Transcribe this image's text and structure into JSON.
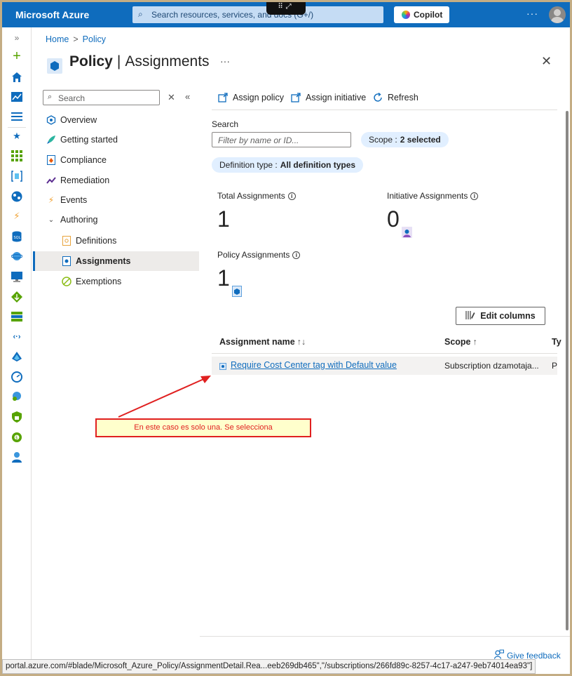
{
  "topbar": {
    "brand": "Microsoft Azure",
    "search_placeholder": "Search resources, services, and docs (G+/)",
    "copilot_label": "Copilot",
    "more": "···"
  },
  "breadcrumb": {
    "home": "Home",
    "policy": "Policy",
    "sep": ">"
  },
  "header": {
    "title_main": "Policy",
    "title_sep": "|",
    "title_sub": "Assignments",
    "more": "···",
    "close": "✕"
  },
  "nav": {
    "search_placeholder": "Search",
    "clear": "✕",
    "collapse": "«",
    "items": [
      {
        "label": "Overview"
      },
      {
        "label": "Getting started"
      },
      {
        "label": "Compliance"
      },
      {
        "label": "Remediation"
      },
      {
        "label": "Events"
      },
      {
        "label": "Authoring"
      },
      {
        "label": "Definitions"
      },
      {
        "label": "Assignments"
      },
      {
        "label": "Exemptions"
      }
    ]
  },
  "toolbar": {
    "assign_policy": "Assign policy",
    "assign_initiative": "Assign initiative",
    "refresh": "Refresh"
  },
  "filters": {
    "search_label": "Search",
    "search_placeholder": "Filter by name or ID...",
    "scope_label": "Scope :",
    "scope_value": "2 selected",
    "deftype_label": "Definition type :",
    "deftype_value": "All definition types"
  },
  "stats": {
    "total_label": "Total Assignments",
    "total_value": "1",
    "initiative_label": "Initiative Assignments",
    "initiative_value": "0",
    "policy_label": "Policy Assignments",
    "policy_value": "1"
  },
  "edit_columns": "Edit columns",
  "table": {
    "columns": [
      "Assignment name",
      "Scope",
      "Ty"
    ],
    "sort_name": "↑↓",
    "sort_scope": "↑",
    "rows": [
      {
        "name": "Require Cost Center tag with Default value",
        "scope": "Subscription dzamotaja...",
        "type": "Po"
      }
    ]
  },
  "annotation": "En este caso es solo una. Se selecciona",
  "feedback": "Give feedback",
  "statusbar": "portal.azure.com/#blade/Microsoft_Azure_Policy/AssignmentDetail.Rea...eeb269db465\",\"/subscriptions/266fd89c-8257-4c17-a247-9eb74014ea93\"]",
  "colors": {
    "brand": "#0f6cbd",
    "annotation_border": "#e02020",
    "annotation_fill": "#ffffcc"
  }
}
